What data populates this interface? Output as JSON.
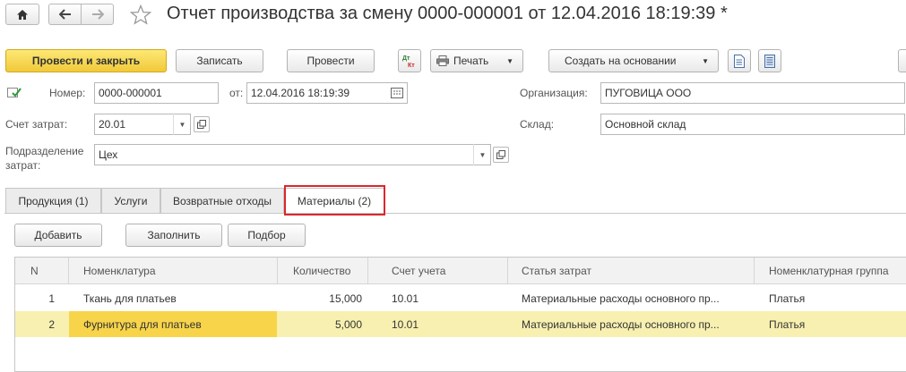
{
  "window": {
    "title": "Отчет производства за смену 0000-000001 от 12.04.2016 18:19:39 *"
  },
  "toolbar": {
    "post_close_label": "Провести и закрыть",
    "save_label": "Записать",
    "post_label": "Провести",
    "print_label": "Печать",
    "create_based_label": "Создать на основании"
  },
  "form": {
    "number_label": "Номер:",
    "number_value": "0000-000001",
    "date_label": "от:",
    "date_value": "12.04.2016 18:19:39",
    "org_label": "Организация:",
    "org_value": "ПУГОВИЦА ООО",
    "cost_account_label": "Счет затрат:",
    "cost_account_value": "20.01",
    "warehouse_label": "Склад:",
    "warehouse_value": "Основной склад",
    "division_label_1": "Подразделение",
    "division_label_2": "затрат:",
    "division_value": "Цех"
  },
  "tabs": [
    {
      "label": "Продукция (1)"
    },
    {
      "label": "Услуги"
    },
    {
      "label": "Возвратные отходы"
    },
    {
      "label": "Материалы (2)"
    }
  ],
  "table_toolbar": {
    "add_label": "Добавить",
    "fill_label": "Заполнить",
    "pick_label": "Подбор"
  },
  "table": {
    "columns": [
      "N",
      "Номенклатура",
      "Количество",
      "Счет учета",
      "Статья затрат",
      "Номенклатурная группа"
    ],
    "rows": [
      {
        "n": "1",
        "item": "Ткань для платьев",
        "qty": "15,000",
        "account": "10.01",
        "cost_item": "Материальные расходы основного пр...",
        "group": "Платья"
      },
      {
        "n": "2",
        "item": "Фурнитура для платьев",
        "qty": "5,000",
        "account": "10.01",
        "cost_item": "Материальные расходы основного пр...",
        "group": "Платья"
      }
    ]
  },
  "colors": {
    "primary_button": "#f1c93a",
    "selected_row": "#f8f0b0",
    "focused_cell": "#f7d44a",
    "highlight_box": "#d9272e"
  }
}
